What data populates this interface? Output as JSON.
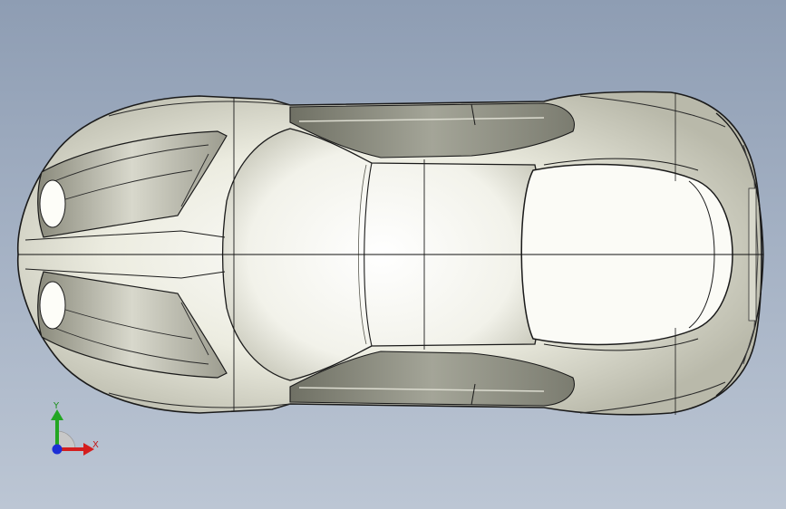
{
  "viewport": {
    "background_top": "#8e9db3",
    "background_bottom": "#bcc6d4"
  },
  "model": {
    "view": "top",
    "surface_color": "#e9eadd",
    "edge_color": "#1a1a1a"
  },
  "triad": {
    "y_label": "Y",
    "x_label": "X",
    "y_color": "#22a622",
    "x_color": "#d41e1e",
    "z_color": "#1c2fd6"
  }
}
